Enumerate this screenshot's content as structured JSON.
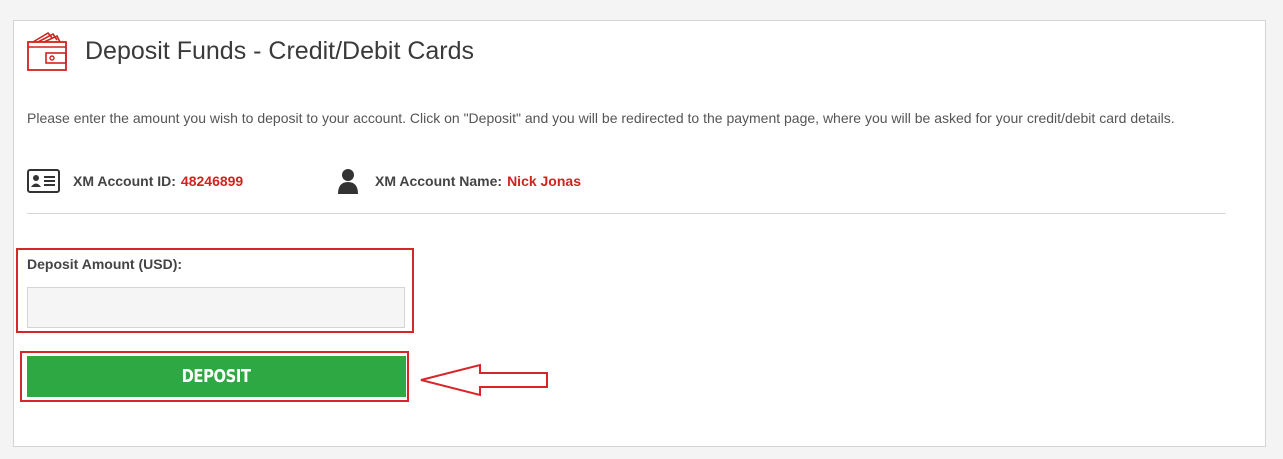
{
  "page": {
    "title": "Deposit Funds - Credit/Debit Cards",
    "header_icon": "wallet-icon",
    "description": "Please enter the amount you wish to deposit to your account. Click on \"Deposit\" and you will be redirected to the payment page, where you will be asked for your credit/debit card details."
  },
  "account": {
    "id_label": "XM Account ID:",
    "id_value": "48246899",
    "id_icon": "id-card-icon",
    "name_label": "XM Account Name:",
    "name_value": "Nick Jonas",
    "name_icon": "person-icon"
  },
  "form": {
    "amount_label": "Deposit Amount (USD):",
    "amount_value": "",
    "amount_placeholder": "",
    "deposit_button_label": "Deposit"
  },
  "colors": {
    "accent_red": "#d0231f",
    "button_green": "#2ea843",
    "highlight_red": "#d7252a"
  },
  "annotations": {
    "highlight_boxes": [
      "amount-field",
      "deposit-button"
    ],
    "arrow_target": "deposit-button"
  }
}
